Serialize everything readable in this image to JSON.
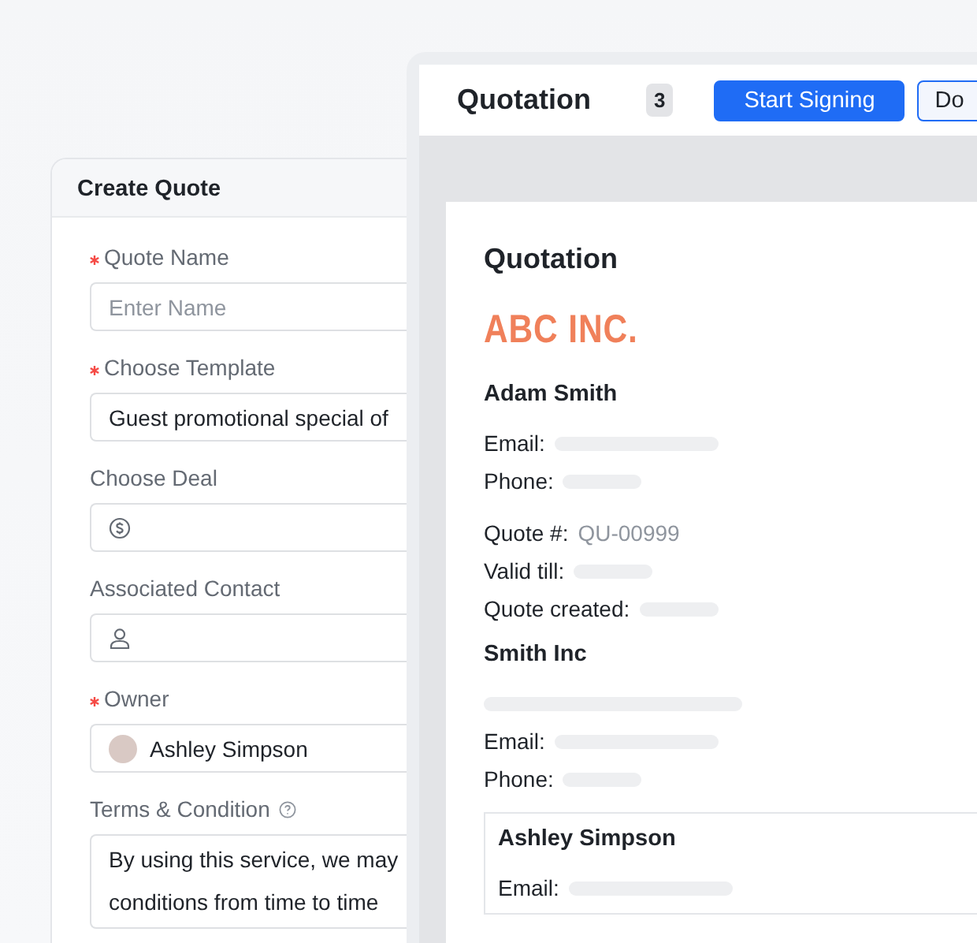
{
  "create_quote": {
    "title": "Create Quote",
    "fields": [
      {
        "kind": "text",
        "label": "Quote Name",
        "required": true,
        "placeholder": "Enter Name"
      },
      {
        "kind": "select",
        "label": "Choose Template",
        "required": true,
        "value": "Guest promotional special of"
      },
      {
        "kind": "icon",
        "label": "Choose Deal",
        "required": false
      },
      {
        "kind": "icon",
        "label": "Associated Contact",
        "required": false
      },
      {
        "kind": "owner",
        "label": "Owner",
        "required": true,
        "value": "Ashley Simpson"
      },
      {
        "kind": "textarea",
        "label": "Terms & Condition",
        "required": false,
        "help": true,
        "lines": [
          "By using this service, we may",
          "conditions from time to time"
        ]
      }
    ]
  },
  "quotation": {
    "title": "Quotation",
    "count": "3",
    "buttons": [
      {
        "label": "Start Signing",
        "kind": "primary"
      },
      {
        "label": "Do",
        "kind": "outline"
      }
    ],
    "document": {
      "title": "Quotation",
      "company": "ABC INC.",
      "sections": [
        {
          "heading": "Adam Smith",
          "rows": [
            {
              "label": "Email:",
              "blur": true
            },
            {
              "label": "Phone:",
              "blur": true
            }
          ]
        },
        {
          "rows": [
            {
              "label": "Quote #:",
              "value": "QU-00999"
            },
            {
              "label": "Valid till:",
              "blur": true
            },
            {
              "label": "Quote created:",
              "blur": true
            }
          ]
        },
        {
          "heading": "Smith Inc",
          "rows": [
            {
              "blur": true
            },
            {
              "label": "Email:",
              "blur": true
            },
            {
              "label": "Phone:",
              "blur": true
            }
          ]
        }
      ],
      "contact": {
        "name": "Ashley Simpson",
        "rows": [
          {
            "label": "Email:",
            "blur": true
          }
        ]
      }
    }
  }
}
